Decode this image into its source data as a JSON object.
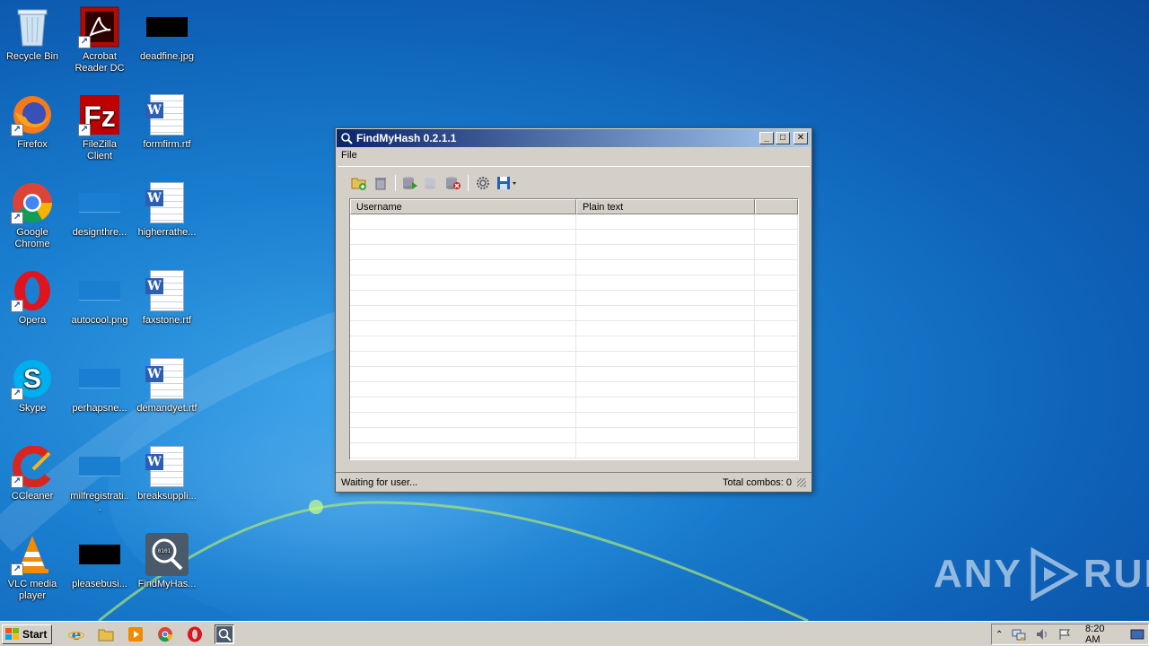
{
  "desktop": {
    "icons": [
      {
        "label": "Recycle Bin"
      },
      {
        "label": "Acrobat Reader DC"
      },
      {
        "label": "deadfine.jpg"
      },
      {
        "label": "Firefox"
      },
      {
        "label": "FileZilla Client"
      },
      {
        "label": "formfirm.rtf"
      },
      {
        "label": "Google Chrome"
      },
      {
        "label": "designthre..."
      },
      {
        "label": "higherrathe..."
      },
      {
        "label": "Opera"
      },
      {
        "label": "autocool.png"
      },
      {
        "label": "faxstone.rtf"
      },
      {
        "label": "Skype"
      },
      {
        "label": "perhapsne..."
      },
      {
        "label": "demandyet.rtf"
      },
      {
        "label": "CCleaner"
      },
      {
        "label": "milfregistrati..."
      },
      {
        "label": "breaksuppli..."
      },
      {
        "label": "VLC media player"
      },
      {
        "label": "pleasebusi..."
      },
      {
        "label": "FindMyHas..."
      }
    ]
  },
  "window": {
    "title": "FindMyHash 0.2.1.1",
    "menu": {
      "file": "File"
    },
    "columns": {
      "username": "Username",
      "plain_text": "Plain text"
    },
    "status": {
      "left": "Waiting for user...",
      "right": "Total combos: 0"
    }
  },
  "watermark": {
    "left": "ANY",
    "right": "RUN"
  },
  "taskbar": {
    "start": "Start",
    "clock": "8:20 AM"
  },
  "colors": {
    "title_start": "#0a246a",
    "title_end": "#a6caf0",
    "desktop": "#1a7fd0"
  }
}
